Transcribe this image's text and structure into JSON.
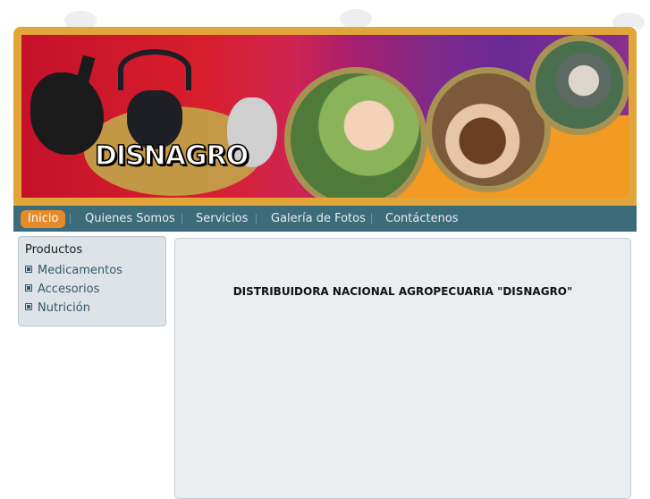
{
  "brand": {
    "logo_text": "DISNAGRO"
  },
  "nav": {
    "items": [
      {
        "label": "Inicio",
        "active": true
      },
      {
        "label": "Quienes Somos",
        "active": false
      },
      {
        "label": "Servicios",
        "active": false
      },
      {
        "label": "Galería de Fotos",
        "active": false
      },
      {
        "label": "Contáctenos",
        "active": false
      }
    ]
  },
  "sidebar": {
    "title": "Productos",
    "items": [
      {
        "label": "Medicamentos"
      },
      {
        "label": "Accesorios"
      },
      {
        "label": "Nutrición"
      }
    ]
  },
  "main": {
    "heading": "DISTRIBUIDORA NACIONAL AGROPECUARIA \"DISNAGRO\""
  },
  "colors": {
    "frame": "#e1a53a",
    "nav_bar": "#3c6b7a",
    "nav_active": "#e58b2a",
    "sidebar_bg": "#dde3e6",
    "content_bg": "#eaeef1"
  },
  "icons": {
    "sidebar_bullet": "square-bullet-icon"
  }
}
